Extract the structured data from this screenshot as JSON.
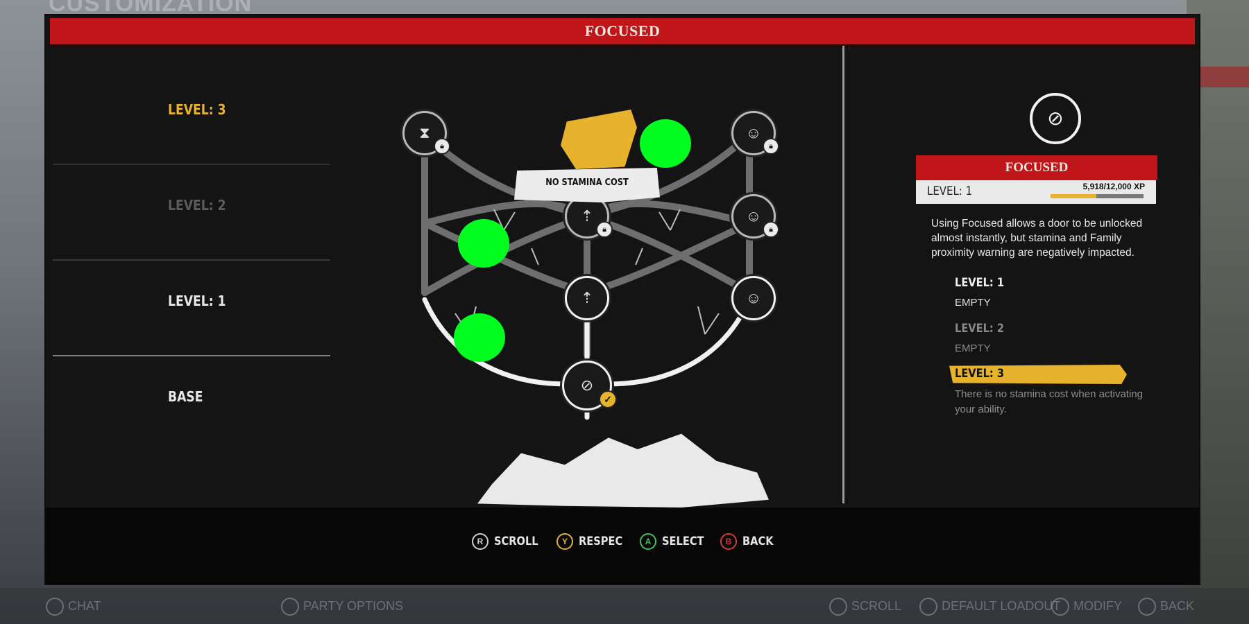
{
  "page": {
    "title": "FOCUSED"
  },
  "left_levels": [
    {
      "label": "LEVEL: 3",
      "state": "active"
    },
    {
      "label": "LEVEL: 2",
      "state": "dim"
    },
    {
      "label": "LEVEL: 1",
      "state": "normal"
    },
    {
      "label": "BASE",
      "state": "normal"
    }
  ],
  "tree": {
    "tooltip": "NO STAMINA COST",
    "nodes": [
      {
        "name": "hourglass",
        "locked": true
      },
      {
        "name": "selected-level3",
        "locked": false
      },
      {
        "name": "family-member-top",
        "locked": true
      },
      {
        "name": "arrows-up-2",
        "locked": true
      },
      {
        "name": "family-member-mid",
        "locked": true
      },
      {
        "name": "arrows-up-1",
        "locked": false
      },
      {
        "name": "family-member-low",
        "locked": false
      },
      {
        "name": "base-lockpick",
        "unlocked_check": true
      }
    ]
  },
  "detail": {
    "title": "FOCUSED",
    "level_label": "LEVEL:",
    "level_value": "1",
    "xp_text": "5,918/12,000 XP",
    "xp_progress": 0.493,
    "description": "Using Focused allows a door to be unlocked almost instantly, but stamina and Family proximity warning are negatively impacted.",
    "levels": [
      {
        "label": "LEVEL: 1",
        "sub": "EMPTY"
      },
      {
        "label": "LEVEL: 2",
        "sub": "EMPTY"
      },
      {
        "label": "LEVEL: 3",
        "sub": "There is no stamina cost when activating your ability."
      }
    ]
  },
  "controls": [
    {
      "button": "R",
      "label": "SCROLL",
      "color": "#cfcfcf"
    },
    {
      "button": "Y",
      "label": "RESPEC",
      "color": "#e7b22c"
    },
    {
      "button": "A",
      "label": "SELECT",
      "color": "#43c15a"
    },
    {
      "button": "B",
      "label": "BACK",
      "color": "#d03a3a"
    }
  ],
  "background": {
    "title": "CUSTOMIZATION",
    "hints": [
      "CHAT",
      "PARTY OPTIONS",
      "SCROLL",
      "DEFAULT LOADOUT",
      "MODIFY",
      "BACK"
    ]
  },
  "colors": {
    "accent_red": "#c0161a",
    "accent_yellow": "#e7b22c",
    "marker_green": "#00ff1f"
  }
}
